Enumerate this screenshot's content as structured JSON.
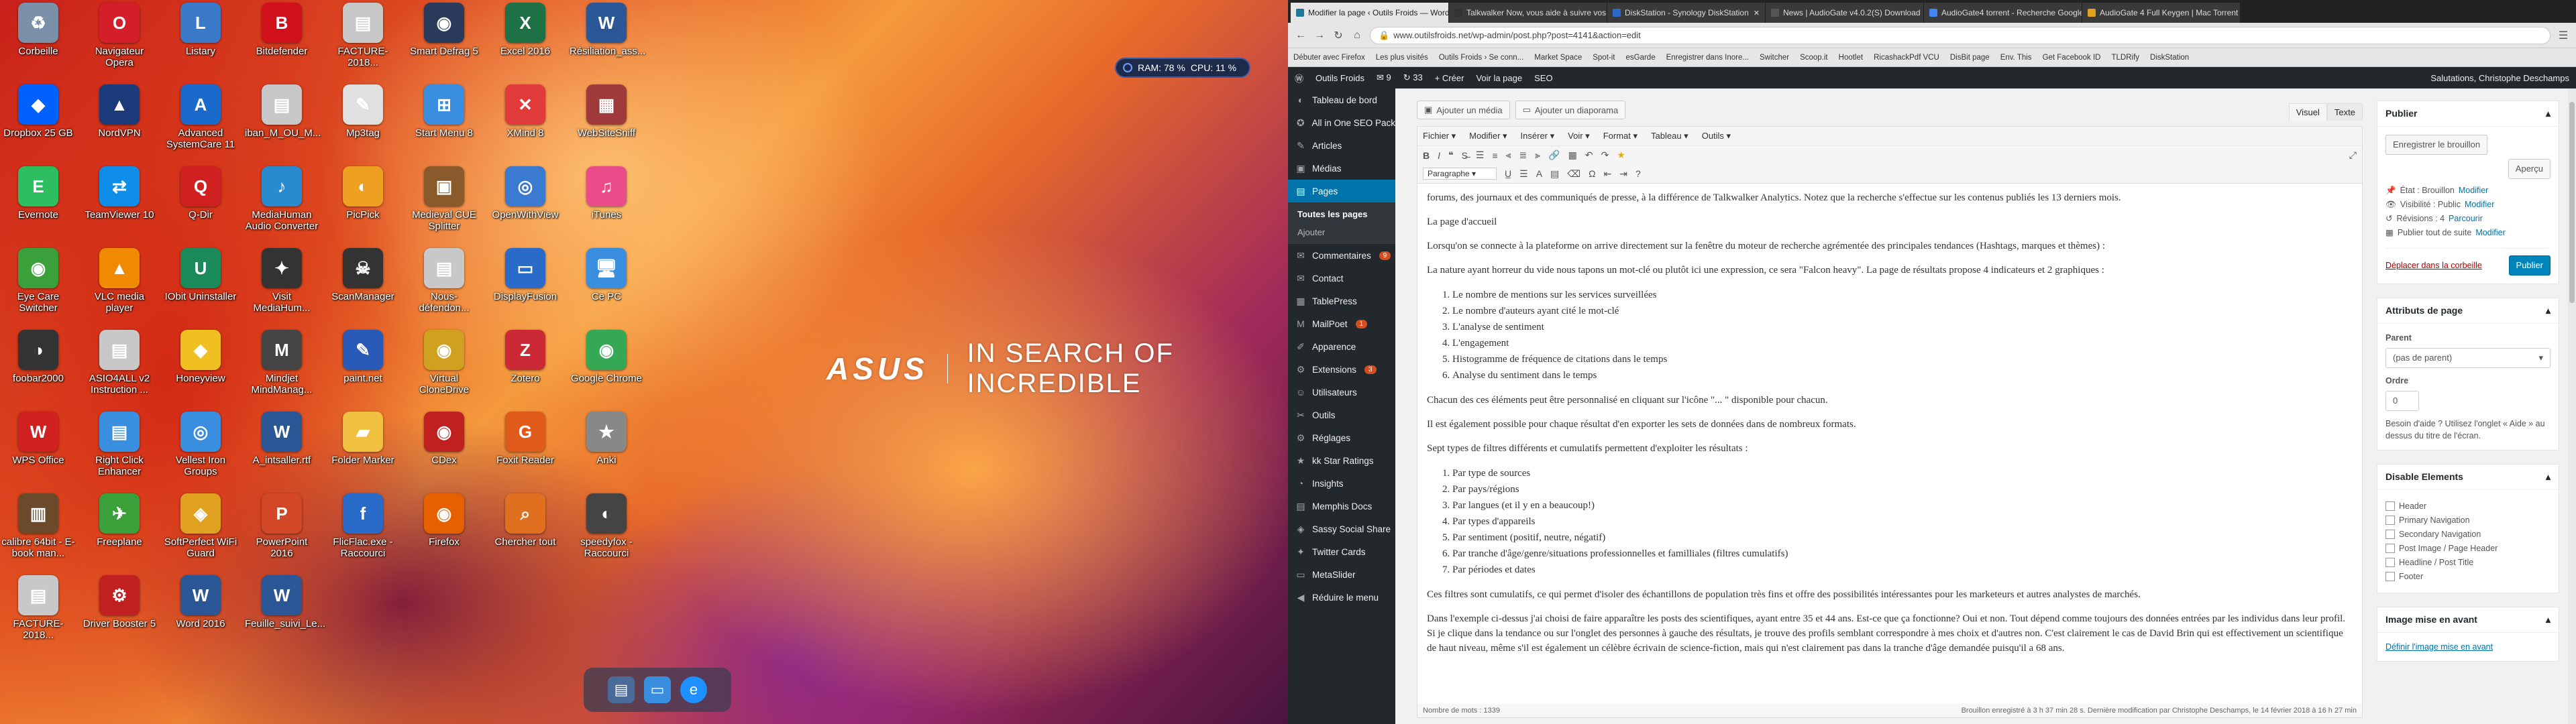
{
  "desktop": {
    "icons": [
      {
        "label": "Corbeille",
        "icon": "recycle-bin-icon",
        "color": "#7a8fa8",
        "glyph": "♻"
      },
      {
        "label": "Navigateur Opera",
        "icon": "opera-icon",
        "color": "#d41e2a",
        "glyph": "O"
      },
      {
        "label": "Listary",
        "icon": "listary-icon",
        "color": "#3a78c8",
        "glyph": "L"
      },
      {
        "label": "Bitdefender",
        "icon": "bitdefender-icon",
        "color": "#d0111a",
        "glyph": "B"
      },
      {
        "label": "FACTURE-2018...",
        "icon": "pdf-icon",
        "color": "#c8c8c8",
        "glyph": "▤"
      },
      {
        "label": "Smart Defrag 5",
        "icon": "defrag-icon",
        "color": "#2a3a5a",
        "glyph": "◉"
      },
      {
        "label": "Excel 2016",
        "icon": "excel-icon",
        "color": "#1e7145",
        "glyph": "X"
      },
      {
        "label": "Résiliation_ass...",
        "icon": "word-doc-icon",
        "color": "#2b5797",
        "glyph": "W"
      },
      {
        "label": "Dropbox 25 GB",
        "icon": "dropbox-icon",
        "color": "#0061ff",
        "glyph": "◆"
      },
      {
        "label": "NordVPN",
        "icon": "nordvpn-icon",
        "color": "#1a3a7a",
        "glyph": "▲"
      },
      {
        "label": "Advanced SystemCare 11",
        "icon": "systemcare-icon",
        "color": "#1a6acc",
        "glyph": "A"
      },
      {
        "label": "iban_M_OU_M...",
        "icon": "pdf-icon",
        "color": "#c8c8c8",
        "glyph": "▤"
      },
      {
        "label": "Mp3tag",
        "icon": "mp3tag-icon",
        "color": "#e0e0e0",
        "glyph": "✎"
      },
      {
        "label": "Start Menu 8",
        "icon": "start-menu-icon",
        "color": "#3a8ee0",
        "glyph": "⊞"
      },
      {
        "label": "XMind 8",
        "icon": "xmind-icon",
        "color": "#e03a3a",
        "glyph": "✕"
      },
      {
        "label": "WebSiteSniff",
        "icon": "website-icon",
        "color": "#a03a3a",
        "glyph": "▦"
      },
      {
        "label": "Evernote",
        "icon": "evernote-icon",
        "color": "#2dbe60",
        "glyph": "E"
      },
      {
        "label": "TeamViewer 10",
        "icon": "teamviewer-icon",
        "color": "#0e8ee9",
        "glyph": "⇄"
      },
      {
        "label": "Q-Dir",
        "icon": "qdir-icon",
        "color": "#d02020",
        "glyph": "Q"
      },
      {
        "label": "MediaHuman Audio Converter",
        "icon": "audio-converter-icon",
        "color": "#2a8ad0",
        "glyph": "♪"
      },
      {
        "label": "PicPick",
        "icon": "picpick-icon",
        "color": "#f0a020",
        "glyph": "◐"
      },
      {
        "label": "Medieval CUE Splitter",
        "icon": "cue-splitter-icon",
        "color": "#8a5a2a",
        "glyph": "▣"
      },
      {
        "label": "OpenWithView",
        "icon": "openwith-icon",
        "color": "#3a7ad0",
        "glyph": "◎"
      },
      {
        "label": "iTunes",
        "icon": "itunes-icon",
        "color": "#ea4c89",
        "glyph": "♫"
      },
      {
        "label": "Eye Care Switcher",
        "icon": "eye-care-icon",
        "color": "#3aa03a",
        "glyph": "◉"
      },
      {
        "label": "VLC media player",
        "icon": "vlc-icon",
        "color": "#f08a00",
        "glyph": "▲"
      },
      {
        "label": "IObit Uninstaller",
        "icon": "iobit-icon",
        "color": "#1a8a5a",
        "glyph": "U"
      },
      {
        "label": "Visit MediaHum...",
        "icon": "mediahuman-icon",
        "color": "#333333",
        "glyph": "✦"
      },
      {
        "label": "ScanManager",
        "icon": "scanmanager-icon",
        "color": "#333333",
        "glyph": "☠"
      },
      {
        "label": "Nous-défendon...",
        "icon": "pdf-icon",
        "color": "#c8c8c8",
        "glyph": "▤"
      },
      {
        "label": "DisplayFusion",
        "icon": "displayfusion-icon",
        "color": "#2a6ac8",
        "glyph": "▭"
      },
      {
        "label": "Ce PC",
        "icon": "computer-icon",
        "color": "#3a8ee0",
        "glyph": "🖥"
      },
      {
        "label": "foobar2000",
        "icon": "foobar-icon",
        "color": "#333333",
        "glyph": "◑"
      },
      {
        "label": "ASIO4ALL v2 Instruction ...",
        "icon": "pdf-icon",
        "color": "#c8c8c8",
        "glyph": "▤"
      },
      {
        "label": "Honeyview",
        "icon": "honeyview-icon",
        "color": "#f0c020",
        "glyph": "◆"
      },
      {
        "label": "Mindjet MindManag...",
        "icon": "mindjet-icon",
        "color": "#444444",
        "glyph": "M"
      },
      {
        "label": "paint.net",
        "icon": "paintnet-icon",
        "color": "#2a5ab8",
        "glyph": "✎"
      },
      {
        "label": "Virtual CloneDrive",
        "icon": "clonedrive-icon",
        "color": "#d0a020",
        "glyph": "◉"
      },
      {
        "label": "Zotero",
        "icon": "zotero-icon",
        "color": "#cc2936",
        "glyph": "Z"
      },
      {
        "label": "Google Chrome",
        "icon": "chrome-icon",
        "color": "#34a853",
        "glyph": "◉"
      },
      {
        "label": "WPS Office",
        "icon": "wps-icon",
        "color": "#d02020",
        "glyph": "W"
      },
      {
        "label": "Right Click Enhancer",
        "icon": "right-click-icon",
        "color": "#3a8ee0",
        "glyph": "▤"
      },
      {
        "label": "Vellest Iron Groups",
        "icon": "vellest-icon",
        "color": "#3a8ee0",
        "glyph": "◎"
      },
      {
        "label": "A_intsaller.rtf",
        "icon": "rtf-icon",
        "color": "#2b5797",
        "glyph": "W"
      },
      {
        "label": "Folder Marker",
        "icon": "folder-marker-icon",
        "color": "#f0c040",
        "glyph": "▰"
      },
      {
        "label": "CDex",
        "icon": "cdex-icon",
        "color": "#c02020",
        "glyph": "◉"
      },
      {
        "label": "Foxit Reader",
        "icon": "foxit-icon",
        "color": "#e05a1a",
        "glyph": "G"
      },
      {
        "label": "Anki",
        "icon": "anki-icon",
        "color": "#888888",
        "glyph": "★"
      },
      {
        "label": "calibre 64bit - E-book man...",
        "icon": "calibre-icon",
        "color": "#6a4a2a",
        "glyph": "▥"
      },
      {
        "label": "Freeplane",
        "icon": "freeplane-icon",
        "color": "#3aa03a",
        "glyph": "✈"
      },
      {
        "label": "SoftPerfect WiFi Guard",
        "icon": "wifi-guard-icon",
        "color": "#e0a020",
        "glyph": "◈"
      },
      {
        "label": "PowerPoint 2016",
        "icon": "powerpoint-icon",
        "color": "#d24726",
        "glyph": "P"
      },
      {
        "label": "FlicFlac.exe - Raccourci",
        "icon": "flicflac-icon",
        "color": "#2a6ac8",
        "glyph": "f"
      },
      {
        "label": "Firefox",
        "icon": "firefox-icon",
        "color": "#e66000",
        "glyph": "◉"
      },
      {
        "label": "Chercher tout",
        "icon": "search-everything-icon",
        "color": "#e07020",
        "glyph": "⌕"
      },
      {
        "label": "speedyfox - Raccourci",
        "icon": "speedyfox-icon",
        "color": "#444444",
        "glyph": "◐"
      },
      {
        "label": "FACTURE-2018...",
        "icon": "pdf-icon",
        "color": "#c8c8c8",
        "glyph": "▤"
      },
      {
        "label": "Driver Booster 5",
        "icon": "driver-booster-icon",
        "color": "#c02020",
        "glyph": "⚙"
      },
      {
        "label": "Word 2016",
        "icon": "word-icon",
        "color": "#2b5797",
        "glyph": "W"
      },
      {
        "label": "Feuille_suivi_Le...",
        "icon": "word-doc-icon",
        "color": "#2b5797",
        "glyph": "W"
      }
    ],
    "wallpaper": {
      "brand": "ASUS",
      "slogan": "IN SEARCH OF INCREDIBLE"
    },
    "meter": {
      "ram": "RAM: 78 %",
      "cpu": "CPU: 11 %"
    }
  },
  "browser": {
    "tabs": [
      {
        "title": "Modifier la page ‹ Outils Froids — WordPress",
        "color": "#21759b"
      },
      {
        "title": "Talkwalker Now, vous aide à suivre vos mentions",
        "color": "#333333"
      },
      {
        "title": "DiskStation - Synology DiskStation",
        "color": "#2a6ac8"
      },
      {
        "title": "News | AudioGate v4.0.2(S) Download",
        "color": "#555555"
      },
      {
        "title": "AudioGate4 torrent - Recherche Google",
        "color": "#4285f4"
      },
      {
        "title": "AudioGate 4 Full Keygen | Mac Torrent",
        "color": "#e0a020"
      }
    ],
    "url": "www.outilsfroids.net/wp-admin/post.php?post=4141&action=edit",
    "bookmarks": [
      "Débuter avec Firefox",
      "Les plus visités",
      "Outils Froids › Se conn...",
      "Market Space",
      "Spot-it",
      "esGarde",
      "Enregistrer dans Inore...",
      "Switcher",
      "Scoop.it",
      "Hootlet",
      "RicashackPdf VCU",
      "DisBit page",
      "Env. This",
      "Get Facebook ID",
      "TLDRify",
      "DiskStation"
    ]
  },
  "adminbar": {
    "site": "Outils Froids",
    "comments": "9",
    "updates": "33",
    "new": "+ Créer",
    "view": "Voir la page",
    "seo": "SEO",
    "greeting": "Salutations, Christophe Deschamps"
  },
  "sidebar": {
    "items": [
      {
        "label": "Tableau de bord",
        "icon": "dashboard-icon",
        "glyph": "◐"
      },
      {
        "label": "All in One SEO Pack",
        "icon": "seo-icon",
        "glyph": "✪"
      },
      {
        "label": "Articles",
        "icon": "pin-icon",
        "glyph": "✎"
      },
      {
        "label": "Médias",
        "icon": "media-icon",
        "glyph": "▣"
      },
      {
        "label": "Pages",
        "icon": "pages-icon",
        "glyph": "▤",
        "current": true
      }
    ],
    "sub": [
      "Toutes les pages",
      "Ajouter"
    ],
    "items2": [
      {
        "label": "Commentaires",
        "icon": "comments-icon",
        "glyph": "✉",
        "badge": "9"
      },
      {
        "label": "Contact",
        "icon": "contact-icon",
        "glyph": "✉"
      },
      {
        "label": "TablePress",
        "icon": "tablepress-icon",
        "glyph": "▦"
      },
      {
        "label": "MailPoet",
        "icon": "mailpoet-icon",
        "glyph": "M",
        "badge": "1"
      },
      {
        "label": "Apparence",
        "icon": "appearance-icon",
        "glyph": "✐"
      },
      {
        "label": "Extensions",
        "icon": "plugins-icon",
        "glyph": "⚙",
        "badge": "3"
      },
      {
        "label": "Utilisateurs",
        "icon": "users-icon",
        "glyph": "☺"
      },
      {
        "label": "Outils",
        "icon": "tools-icon",
        "glyph": "✂"
      },
      {
        "label": "Réglages",
        "icon": "settings-icon",
        "glyph": "⚙"
      },
      {
        "label": "kk Star Ratings",
        "icon": "star-icon",
        "glyph": "★"
      },
      {
        "label": "Insights",
        "icon": "insights-icon",
        "glyph": "◔"
      },
      {
        "label": "Memphis Docs",
        "icon": "docs-icon",
        "glyph": "▤"
      },
      {
        "label": "Sassy Social Share",
        "icon": "share-icon",
        "glyph": "◈"
      },
      {
        "label": "Twitter Cards",
        "icon": "twitter-icon",
        "glyph": "✦"
      },
      {
        "label": "MetaSlider",
        "icon": "slider-icon",
        "glyph": "▭"
      },
      {
        "label": "Réduire le menu",
        "icon": "collapse-icon",
        "glyph": "◀"
      }
    ]
  },
  "editor": {
    "add_media": "Ajouter un média",
    "add_slideshow": "Ajouter un diaporama",
    "visual": "Visuel",
    "text": "Texte",
    "menus": [
      "Fichier",
      "Modifier",
      "Insérer",
      "Voir",
      "Format",
      "Tableau",
      "Outils"
    ],
    "paragraph": "Paragraphe",
    "p1": "forums, des journaux et des communiqués de presse, à la différence de Talkwalker Analytics. Notez que la recherche s'effectue sur les contenus publiés les 13 derniers mois.",
    "p2": "La page d'accueil",
    "p3": "Lorsqu'on se connecte à la plateforme on arrive directement sur la fenêtre du moteur de recherche agrémentée des principales tendances (Hashtags, marques et thèmes) :",
    "p4": "La nature ayant horreur du vide nous tapons un mot-clé ou plutôt ici une expression, ce sera \"Falcon heavy\". La page de résultats propose 4 indicateurs et 2 graphiques :",
    "list1": [
      "Le nombre de mentions sur les services surveillées",
      "Le nombre d'auteurs ayant cité le mot-clé",
      "L'analyse de sentiment",
      "L'engagement",
      "Histogramme de fréquence de citations dans le temps",
      "Analyse du sentiment dans le temps"
    ],
    "p5": "Chacun des ces éléments peut être personnalisé en cliquant sur l'icône \"... \" disponible pour chacun.",
    "p6": "Il est également possible pour chaque résultat d'en exporter les sets de données dans de nombreux formats.",
    "p7": "Sept types de filtres différents et cumulatifs permettent d'exploiter les résultats :",
    "list2": [
      "Par type de sources",
      "Par pays/régions",
      "Par langues (et il y en a beaucoup!)",
      "Par types d'appareils",
      "Par sentiment (positif, neutre, négatif)",
      "Par tranche d'âge/genre/situations professionnelles et familliales (filtres cumulatifs)",
      "Par périodes et dates"
    ],
    "p8": "Ces filtres sont cumulatifs, ce qui permet d'isoler des échantillons de population très fins et offre des possibilités intéressantes pour les marketeurs et autres analystes de marchés.",
    "p9": "Dans l'exemple ci-dessus j'ai choisi de faire apparaître les posts des scientifiques, ayant entre 35 et 44 ans. Est-ce que ça fonctionne? Oui et non. Tout dépend comme toujours des données entrées par les individus dans leur profil. Si je clique dans la tendance ou sur l'onglet des personnes à gauche des résultats, je trouve des profils semblant correspondre à mes choix et d'autres non. C'est clairement le cas de David Brin qui est effectivement un scientifique de haut niveau, même s'il est également un célèbre écrivain de science-fiction, mais qui n'est clairement pas dans la tranche d'âge demandée puisqu'il a 68 ans.",
    "word_count": "Nombre de mots : 1339",
    "draft_status": "Brouillon enregistré à 3 h 37 min 28 s. Dernière modification par Christophe Deschamps, le 14 février 2018 à 16 h 27 min"
  },
  "publish": {
    "title": "Publier",
    "save_draft": "Enregistrer le brouillon",
    "preview": "Aperçu",
    "state": "État : Brouillon",
    "visibility": "Visibilité : Public",
    "revisions": "Révisions : 4",
    "revisions_link": "Parcourir",
    "publish_now": "Publier tout de suite",
    "edit": "Modifier",
    "trash": "Déplacer dans la corbeille",
    "publish_btn": "Publier"
  },
  "attributes": {
    "title": "Attributs de page",
    "parent_label": "Parent",
    "parent_value": "(pas de parent)",
    "order_label": "Ordre",
    "order_value": "0",
    "help": "Besoin d'aide ? Utilisez l'onglet « Aide » au dessus du titre de l'écran."
  },
  "disable": {
    "title": "Disable Elements",
    "options": [
      "Header",
      "Primary Navigation",
      "Secondary Navigation",
      "Post Image / Page Header",
      "Headline / Post Title",
      "Footer"
    ]
  },
  "featured": {
    "title": "Image mise en avant",
    "link": "Définir l'image mise en avant"
  }
}
